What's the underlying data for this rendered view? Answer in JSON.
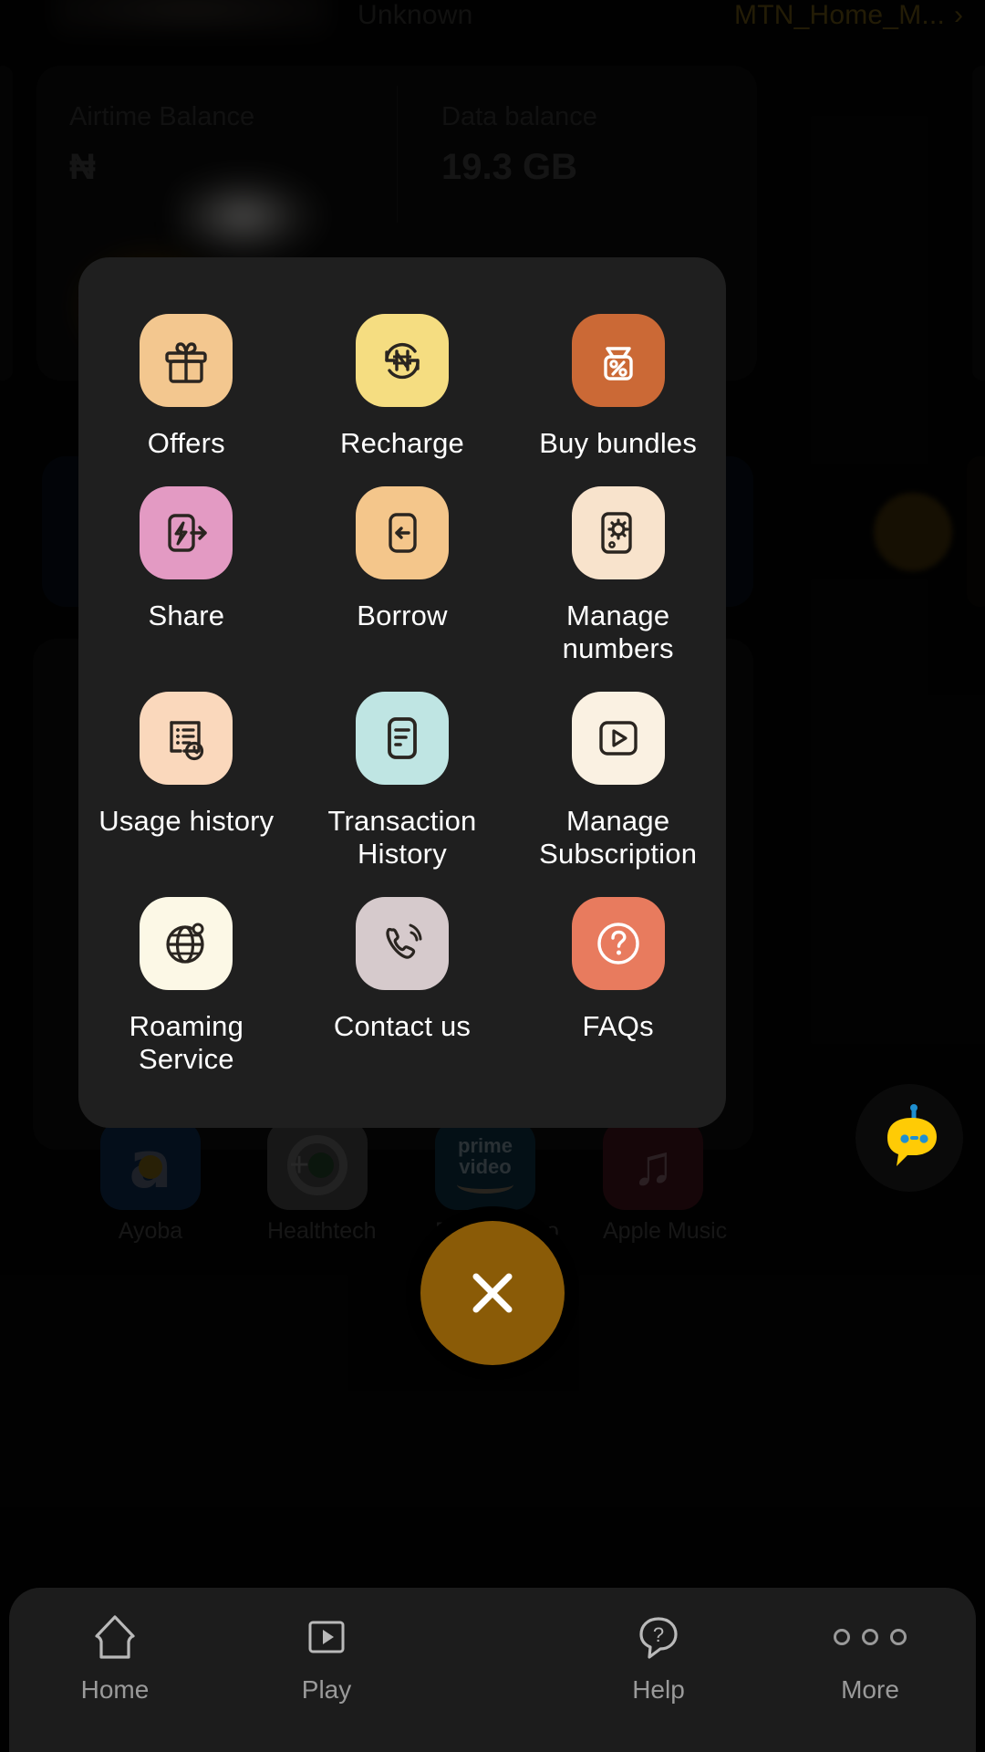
{
  "background": {
    "header": {
      "unknown_label": "Unknown",
      "profile_name": "MTN_Home_M...",
      "chevron": "›"
    },
    "balance_card": {
      "airtime": {
        "title": "Airtime Balance",
        "value": "₦"
      },
      "data": {
        "title": "Data balance",
        "value": "19.3 GB"
      }
    },
    "apps": [
      {
        "name": "Ayoba",
        "glyph": "a"
      },
      {
        "name": "Healthtech",
        "glyph": "+"
      },
      {
        "name": "Prime Video",
        "line1": "prime",
        "line2": "video"
      },
      {
        "name": "Apple Music",
        "glyph": "♫"
      }
    ]
  },
  "sheet": {
    "items": [
      {
        "label": "Offers",
        "icon": "gift-icon",
        "bg": "#F3C78F"
      },
      {
        "label": "Recharge",
        "icon": "naira-refresh-icon",
        "bg": "#F5DD81"
      },
      {
        "label": "Buy bundles",
        "icon": "bundle-percent-icon",
        "bg": "#CB6936"
      },
      {
        "label": "Share",
        "icon": "phone-share-icon",
        "bg": "#E39AC3"
      },
      {
        "label": "Borrow",
        "icon": "phone-arrow-left-icon",
        "bg": "#F4C68B"
      },
      {
        "label": "Manage numbers",
        "icon": "phone-gear-icon",
        "bg": "#F8E3CC"
      },
      {
        "label": "Usage history",
        "icon": "usage-clipboard-icon",
        "bg": "#FAD8BC"
      },
      {
        "label": "Transaction History",
        "icon": "document-lines-icon",
        "bg": "#BFE5E3"
      },
      {
        "label": "Manage Subscription",
        "icon": "play-box-icon",
        "bg": "#FAF1E2"
      },
      {
        "label": "Roaming Service",
        "icon": "globe-pin-icon",
        "bg": "#FCF8E6"
      },
      {
        "label": "Contact us",
        "icon": "phone-call-icon",
        "bg": "#D6CACC"
      },
      {
        "label": "FAQs",
        "icon": "question-circle-icon",
        "bg": "#E87B5E"
      }
    ]
  },
  "chatbot": {
    "name": "chat-assistant"
  },
  "close_button": {
    "symbol": "✕"
  },
  "bottom_nav": {
    "items": [
      {
        "label": "Home",
        "icon": "home-icon"
      },
      {
        "label": "Play",
        "icon": "play-icon"
      },
      {
        "label": "Help",
        "icon": "help-icon"
      },
      {
        "label": "More",
        "icon": "more-icon"
      }
    ]
  },
  "colors": {
    "sheet_bg": "#1F1F1F",
    "nav_bg": "#1C1C1C",
    "close_fab": "#8A5B07",
    "brand_yellow": "#FFCB05",
    "label_text": "#FFFFFF",
    "nav_text": "#9A9A9A"
  }
}
